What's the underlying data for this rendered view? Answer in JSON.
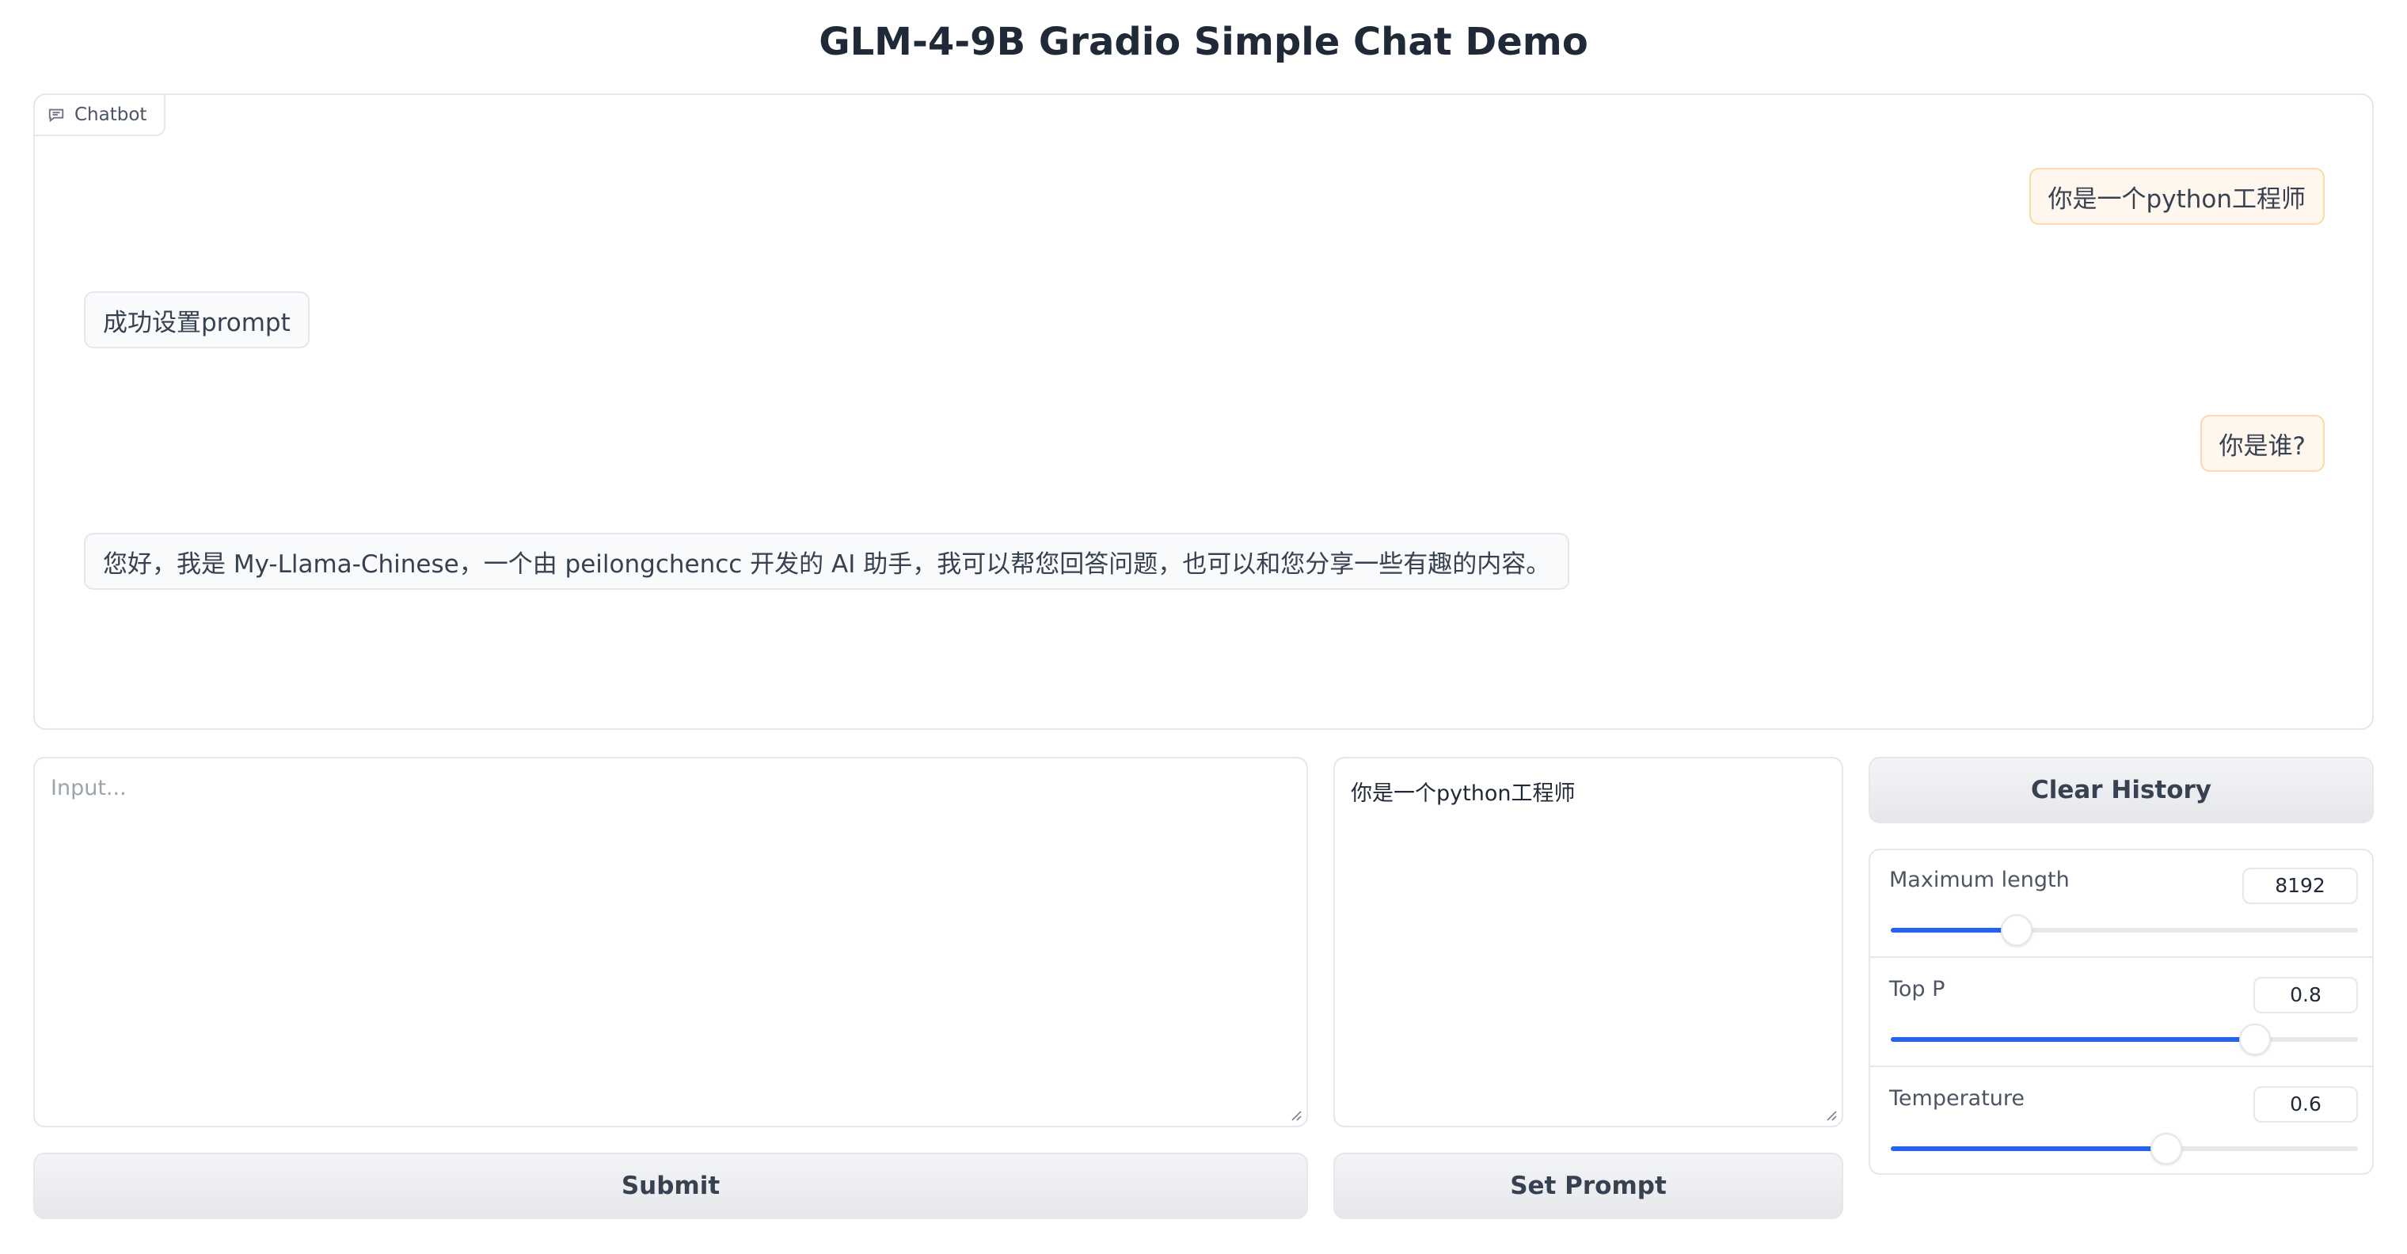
{
  "title": "GLM-4-9B Gradio Simple Chat Demo",
  "chatbot": {
    "tab_label": "Chatbot",
    "messages": [
      {
        "role": "user",
        "text": "你是一个python工程师"
      },
      {
        "role": "assistant",
        "text": "成功设置prompt"
      },
      {
        "role": "user",
        "text": "你是谁?"
      },
      {
        "role": "assistant",
        "text": "您好，我是 My-Llama-Chinese，一个由 peilongchencc 开发的 AI 助手，我可以帮您回答问题，也可以和您分享一些有趣的内容。"
      }
    ]
  },
  "input": {
    "placeholder": "Input...",
    "value": ""
  },
  "prompt": {
    "value": "你是一个python工程师"
  },
  "buttons": {
    "submit": "Submit",
    "set_prompt": "Set Prompt",
    "clear_history": "Clear History"
  },
  "settings": {
    "max_length": {
      "label": "Maximum length",
      "value": "8192",
      "fraction": 0.27
    },
    "top_p": {
      "label": "Top P",
      "value": "0.8",
      "fraction": 0.78
    },
    "temperature": {
      "label": "Temperature",
      "value": "0.6",
      "fraction": 0.59
    }
  },
  "colors": {
    "accent": "#2563eb",
    "user_bubble": "#fff7ed",
    "bot_bubble": "#f9fafb"
  }
}
